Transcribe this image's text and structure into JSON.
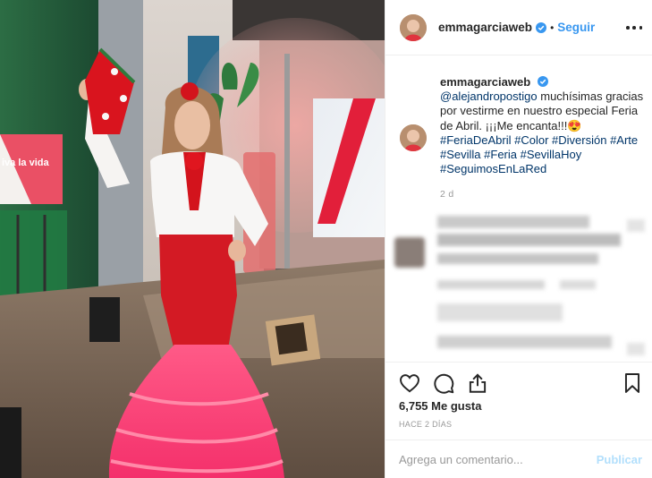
{
  "post": {
    "username": "emmagarciaweb",
    "follow_label": "Seguir",
    "dot": "•",
    "caption": {
      "username": "emmagarciaweb",
      "mention": "@alejandropostigo",
      "text": "muchísimas gracias por vestirme en nuestro especial Feria de Abril. ¡¡¡Me encanta!!!",
      "emoji": "😍",
      "hashtags": [
        "#FeriaDeAbril",
        "#Color",
        "#Diversión",
        "#Arte",
        "#Sevilla",
        "#Feria",
        "#SevillaHoy",
        "#SeguimosEnLaRed"
      ],
      "time": "2 d"
    },
    "likes": "6,755 Me gusta",
    "time_ago": "HACE 2 DÍAS",
    "comment_placeholder": "Agrega un comentario...",
    "publish_label": "Publicar",
    "photo_sign_text": "iva la vida"
  },
  "icons": [
    "verified-icon",
    "more-options-icon",
    "like-icon",
    "comment-icon",
    "share-icon",
    "save-icon"
  ],
  "colors": {
    "link": "#003569",
    "follow": "#3897f0",
    "publish_disabled": "#b2dffc",
    "muted": "#999999",
    "border": "#efefef"
  }
}
